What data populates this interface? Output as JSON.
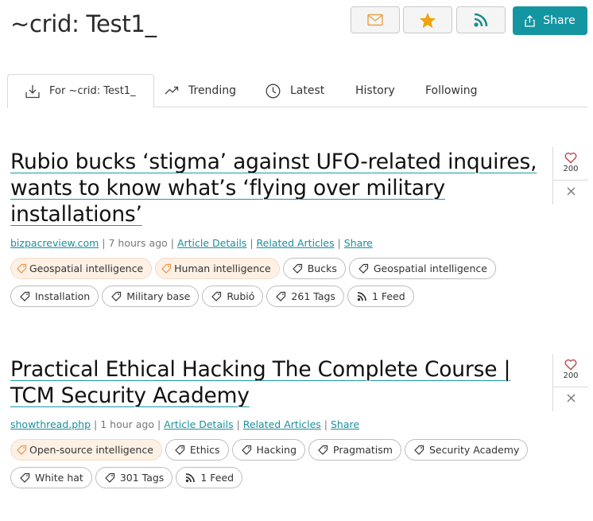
{
  "header": {
    "title": "~crid: Test1_",
    "share_label": "Share"
  },
  "tabs": [
    {
      "label": "For ~crid: Test1_",
      "icon": "download-tray-icon",
      "active": true
    },
    {
      "label": "Trending",
      "icon": "trending-up-icon"
    },
    {
      "label": "Latest",
      "icon": "clock-icon"
    },
    {
      "label": "History"
    },
    {
      "label": "Following"
    }
  ],
  "articles": [
    {
      "title": "Rubio bucks ‘stigma’ against UFO-related inquires, wants to know what’s ‘flying over military installations’",
      "source": "bizpacreview.com",
      "time": "7 hours ago",
      "details_label": "Article Details",
      "related_label": "Related Articles",
      "share_label": "Share",
      "likes": "200",
      "tags_hl": [
        "Geospatial intelligence",
        "Human intelligence"
      ],
      "tags": [
        "Bucks",
        "Geospatial intelligence",
        "Installation",
        "Military base",
        "Rubió"
      ],
      "tag_count": "261 Tags",
      "feed_count": "1 Feed"
    },
    {
      "title": "Practical Ethical Hacking The Complete Course | TCM Security Academy",
      "source": "showthread.php",
      "time": "1 hour ago",
      "details_label": "Article Details",
      "related_label": "Related Articles",
      "share_label": "Share",
      "likes": "200",
      "tags_hl": [
        "Open-source intelligence"
      ],
      "tags": [
        "Ethics",
        "Hacking",
        "Pragmatism",
        "Security Academy",
        "White hat"
      ],
      "tag_count": "301 Tags",
      "feed_count": "1 Feed"
    }
  ],
  "colors": {
    "accent": "#1495a2",
    "star": "#f0a20c",
    "mail": "#e5a24a",
    "rss": "#1a8f8a",
    "heart": "#c0444a"
  }
}
